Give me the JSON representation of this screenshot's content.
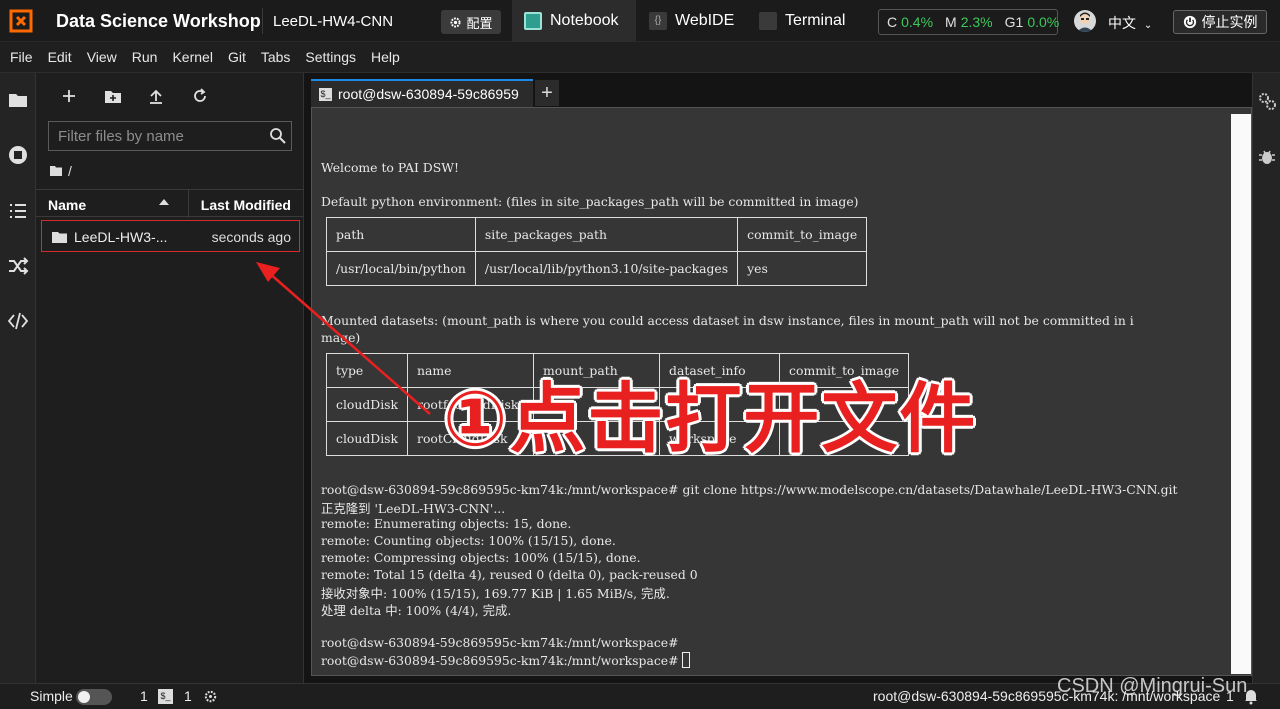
{
  "topbar": {
    "app_title": "Data Science Workshop",
    "project": "LeeDL-HW4-CNN",
    "config_label": "配置",
    "tabs": [
      {
        "label": "Notebook",
        "active": true
      },
      {
        "label": "WebIDE",
        "active": false
      },
      {
        "label": "Terminal",
        "active": false
      }
    ],
    "resources": {
      "c_label": "C",
      "c_value": "0.4%",
      "m_label": "M",
      "m_value": "2.3%",
      "g_label": "G1",
      "g_value": "0.0%"
    },
    "language": "中文",
    "stop_label": "停止实例",
    "colors": {
      "accent_green": "#3cc95b",
      "logo_orange": "#ff6a00"
    }
  },
  "menu": [
    "File",
    "Edit",
    "View",
    "Run",
    "Kernel",
    "Git",
    "Tabs",
    "Settings",
    "Help"
  ],
  "filebrowser": {
    "filter_placeholder": "Filter files by name",
    "breadcrumb": "/",
    "col_name": "Name",
    "col_modified": "Last Modified",
    "rows": [
      {
        "name": "LeeDL-HW3-...",
        "modified": "seconds ago"
      }
    ]
  },
  "terminal": {
    "tab_title": "root@dsw-630894-59c86959",
    "welcome": "Welcome to PAI DSW!",
    "env_line": "Default python environment: (files in site_packages_path will be committed in image)",
    "env_table": {
      "headers": [
        "path",
        "site_packages_path",
        "commit_to_image"
      ],
      "row": [
        "/usr/local/bin/python",
        "/usr/local/lib/python3.10/site-packages",
        "yes"
      ]
    },
    "mounted_line1": "Mounted datasets: (mount_path is where you could access dataset in dsw instance, files in mount_path will not be committed in i",
    "mounted_line2": "mage)",
    "ds_table": {
      "headers": [
        "type",
        "name",
        "mount_path",
        "dataset_info",
        "commit_to_image"
      ],
      "rows": [
        [
          "cloudDisk",
          "rootfsCloudDisk",
          "",
          "",
          "n"
        ],
        [
          "cloudDisk",
          "rootCloudDisk",
          "",
          "workspace",
          "n"
        ]
      ]
    },
    "lines": [
      "root@dsw-630894-59c869595c-km74k:/mnt/workspace# git clone https://www.modelscope.cn/datasets/Datawhale/LeeDL-HW3-CNN.git",
      "正克隆到 'LeeDL-HW3-CNN'...",
      "remote: Enumerating objects: 15, done.",
      "remote: Counting objects: 100% (15/15), done.",
      "remote: Compressing objects: 100% (15/15), done.",
      "remote: Total 15 (delta 4), reused 0 (delta 0), pack-reused 0",
      "接收对象中: 100% (15/15), 169.77 KiB | 1.65 MiB/s, 完成.",
      "处理 delta 中: 100% (4/4), 完成.",
      "",
      "root@dsw-630894-59c869595c-km74k:/mnt/workspace#",
      "root@dsw-630894-59c869595c-km74k:/mnt/workspace#"
    ]
  },
  "statusbar": {
    "mode": "Simple",
    "count1": "1",
    "count2": "1",
    "right_text": "root@dsw-630894-59c869595c-km74k: /mnt/workspace",
    "right_count": "1"
  },
  "annotation": {
    "text": "①点击打开文件",
    "color": "#e8201f"
  },
  "watermark": "CSDN @Mingrui-Sun"
}
